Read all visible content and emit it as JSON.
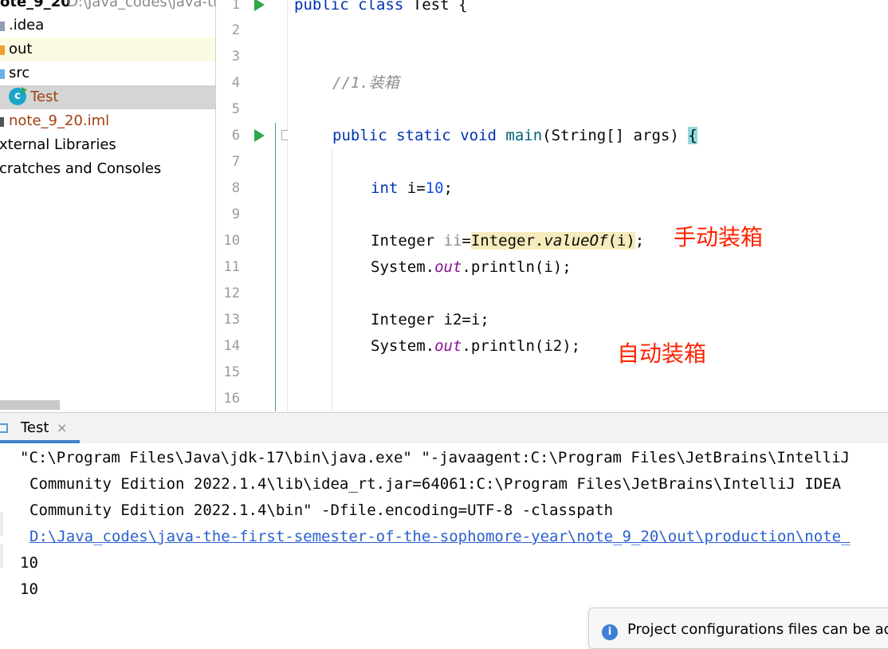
{
  "project": {
    "root_name": "ote_9_20",
    "root_path": "D:\\Java_codes\\java-th",
    "items": [
      {
        "label": ".idea",
        "icon": "folder-icon",
        "color": "#8c9db0"
      },
      {
        "label": "out",
        "icon": "folder-icon",
        "color": "#f0a030"
      },
      {
        "label": "src",
        "icon": "folder-icon",
        "color": "#6ab0e0"
      },
      {
        "label": "Test",
        "icon": "java-class-icon"
      },
      {
        "label": "note_9_20.iml",
        "icon": "module-file-icon"
      },
      {
        "label": "xternal Libraries",
        "icon": "library-icon"
      },
      {
        "label": "cratches and Consoles",
        "icon": "scratches-icon"
      }
    ]
  },
  "editor": {
    "line_numbers": [
      "1",
      "2",
      "3",
      "4",
      "5",
      "6",
      "7",
      "8",
      "9",
      "10",
      "11",
      "12",
      "13",
      "14",
      "15",
      "16"
    ],
    "tokens": {
      "public": "public",
      "class": "class",
      "test_name": "Test {",
      "comment": "//1.装箱",
      "static": "static",
      "void": "void",
      "main": "main",
      "main_args": "(String[] args) ",
      "open_brace": "{",
      "int": "int",
      "i_assign": " i=",
      "ten": "10",
      "semi": ";",
      "integer": "Integer ",
      "ii": "ii",
      "eq": "=",
      "integer2": "Integer.",
      "valueof": "valueOf",
      "valueof_args": "(i)",
      "system": "System.",
      "out": "out",
      "println_i": ".println(i);",
      "i2_decl": "Integer i2=i;",
      "println_i2": ".println(i2);"
    },
    "annotations": {
      "manual_boxing": "手动装箱",
      "auto_boxing": "自动装箱"
    }
  },
  "run": {
    "tab_label": "Test",
    "tab_close": "×",
    "console_lines": [
      "\"C:\\Program Files\\Java\\jdk-17\\bin\\java.exe\" \"-javaagent:C:\\Program Files\\JetBrains\\IntelliJ",
      "Community Edition 2022.1.4\\lib\\idea_rt.jar=64061:C:\\Program Files\\JetBrains\\IntelliJ IDEA",
      "Community Edition 2022.1.4\\bin\" -Dfile.encoding=UTF-8 -classpath",
      "D:\\Java_codes\\java-the-first-semester-of-the-sophomore-year\\note_9_20\\out\\production\\note_",
      "10",
      "10"
    ]
  },
  "notification": {
    "text": "Project configurations files can be add"
  }
}
